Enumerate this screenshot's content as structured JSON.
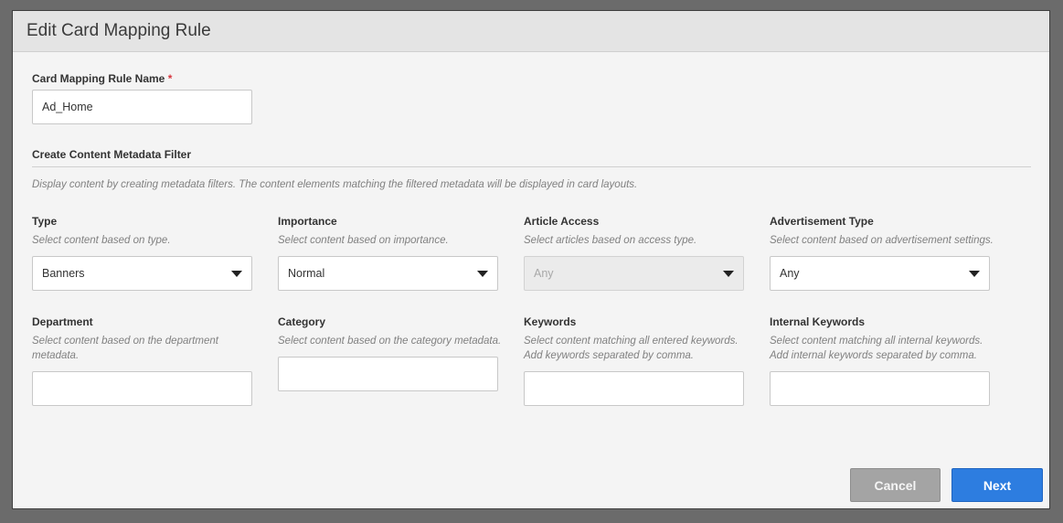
{
  "dialog": {
    "title": "Edit Card Mapping Rule"
  },
  "rule_name": {
    "label": "Card Mapping Rule Name",
    "required_mark": "*",
    "value": "Ad_Home"
  },
  "filter": {
    "section_title": "Create Content Metadata Filter",
    "description": "Display content by creating metadata filters. The content elements matching the filtered metadata will be displayed in card layouts."
  },
  "fields": {
    "type": {
      "label": "Type",
      "hint": "Select content based on type.",
      "value": "Banners"
    },
    "importance": {
      "label": "Importance",
      "hint": "Select content based on importance.",
      "value": "Normal"
    },
    "article_access": {
      "label": "Article Access",
      "hint": "Select articles based on access type.",
      "value": "Any"
    },
    "ad_type": {
      "label": "Advertisement Type",
      "hint": "Select content based on advertisement settings.",
      "value": "Any"
    },
    "department": {
      "label": "Department",
      "hint_1": "Select content based on the department",
      "hint_2": "metadata.",
      "value": ""
    },
    "category": {
      "label": "Category",
      "hint": "Select content based on the category metadata.",
      "value": ""
    },
    "keywords": {
      "label": "Keywords",
      "hint_1": "Select content matching all entered keywords.",
      "hint_2": "Add keywords separated by comma.",
      "value": ""
    },
    "internal_keywords": {
      "label": "Internal Keywords",
      "hint_1": "Select content matching all internal keywords.",
      "hint_2": "Add internal keywords separated by comma.",
      "value": ""
    }
  },
  "buttons": {
    "cancel": "Cancel",
    "next": "Next"
  },
  "colors": {
    "primary": "#2d7de0",
    "required": "#d7373f"
  }
}
